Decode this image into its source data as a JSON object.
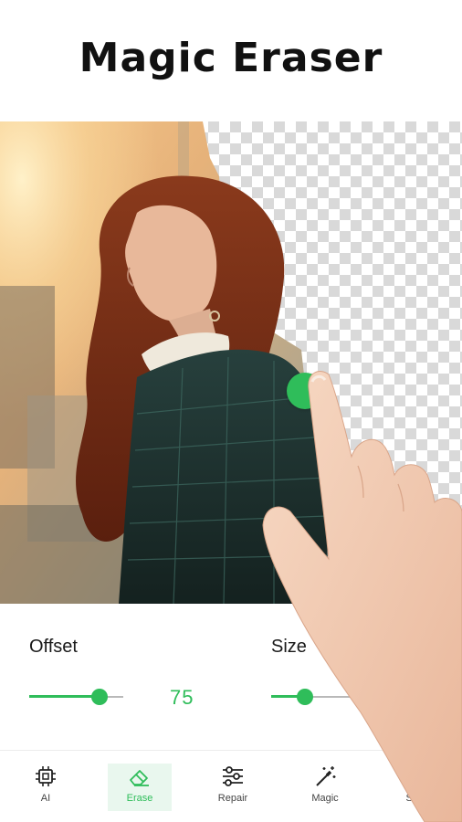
{
  "headline": "Magic Eraser",
  "accent_color": "#2fbd5a",
  "editor": {
    "photo_description_icon": "woman-portrait-image",
    "erased_area_pattern": "transparency-checkerboard"
  },
  "controls": {
    "offset": {
      "label": "Offset",
      "value_text": "75",
      "level_fraction": 0.75
    },
    "size": {
      "label": "Size",
      "level_fraction": 0.36
    }
  },
  "tabs": [
    {
      "label": "AI",
      "icon": "chip-icon",
      "active": false
    },
    {
      "label": "Erase",
      "icon": "eraser-icon",
      "active": true
    },
    {
      "label": "Repair",
      "icon": "sliders-icon",
      "active": false
    },
    {
      "label": "Magic",
      "icon": "magic-wand-icon",
      "active": false
    },
    {
      "label": "Smooth",
      "icon": "waves-icon",
      "active": false
    }
  ]
}
